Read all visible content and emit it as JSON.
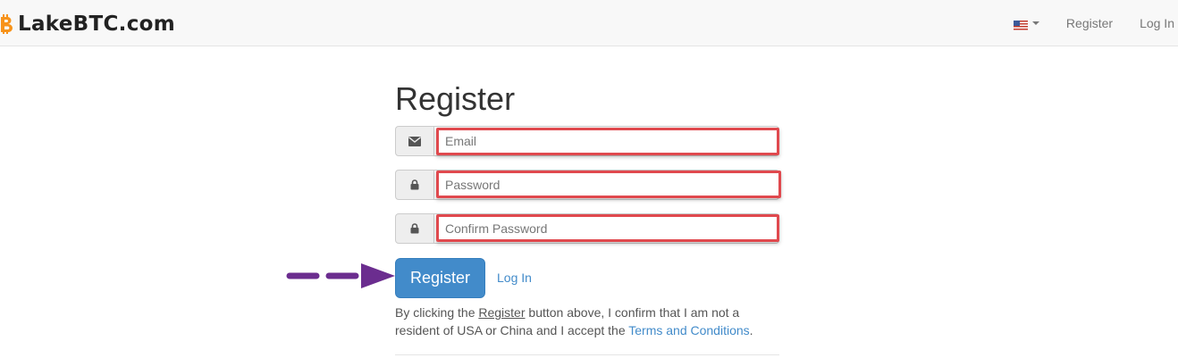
{
  "brand": {
    "name": "LakeBTC.com",
    "icon": "bitcoin-icon"
  },
  "nav": {
    "language_icon": "us-flag-icon",
    "register": "Register",
    "login": "Log In"
  },
  "form": {
    "title": "Register",
    "email_placeholder": "Email",
    "password_placeholder": "Password",
    "confirm_placeholder": "Confirm Password",
    "submit_label": "Register",
    "login_link": "Log In",
    "notice": {
      "part1": "By clicking the ",
      "register_word": "Register",
      "part2": " button above, I confirm that I am not a resident of USA or China and I accept the ",
      "terms_link": "Terms and Conditions",
      "part3": "."
    }
  },
  "colors": {
    "primary": "#428bca",
    "highlight_box": "#e0494e",
    "arrow": "#6b2d8f",
    "bitcoin": "#f7931a"
  }
}
